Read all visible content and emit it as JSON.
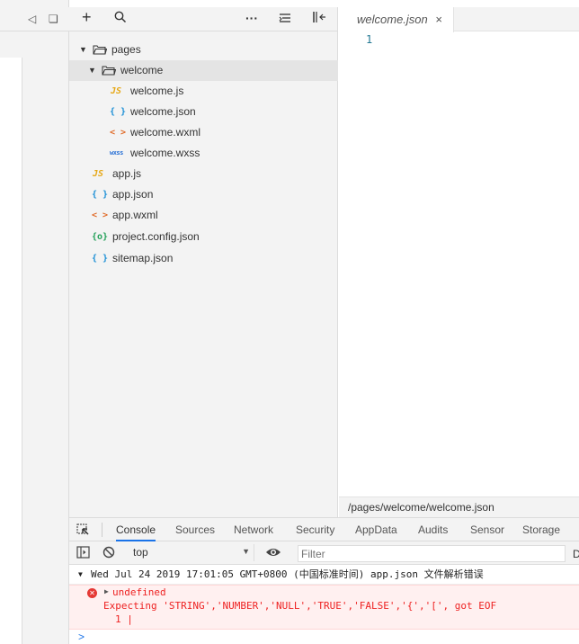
{
  "explorer": {
    "toolbar": {
      "add": "+",
      "more": "···"
    },
    "tree": [
      {
        "name": "pages",
        "type": "folder"
      },
      {
        "name": "welcome",
        "type": "folder"
      },
      {
        "name": "welcome.js",
        "type": "js",
        "icon": "JS"
      },
      {
        "name": "welcome.json",
        "type": "json",
        "icon": "{ }"
      },
      {
        "name": "welcome.wxml",
        "type": "wxml",
        "icon": "< >"
      },
      {
        "name": "welcome.wxss",
        "type": "wxss",
        "icon": "wxss"
      },
      {
        "name": "app.js",
        "type": "js",
        "icon": "JS"
      },
      {
        "name": "app.json",
        "type": "json",
        "icon": "{ }"
      },
      {
        "name": "app.wxml",
        "type": "wxml",
        "icon": "< >"
      },
      {
        "name": "project.config.json",
        "type": "config",
        "icon": "{o}"
      },
      {
        "name": "sitemap.json",
        "type": "json",
        "icon": "{ }"
      }
    ]
  },
  "editor": {
    "tab_title": "welcome.json",
    "tab_close": "×",
    "line_number": "1",
    "status_path": "/pages/welcome/welcome.json"
  },
  "devtools": {
    "tabs": [
      "Console",
      "Sources",
      "Network",
      "Security",
      "AppData",
      "Audits",
      "Sensor",
      "Storage"
    ],
    "context": "top",
    "filter_placeholder": "Filter",
    "right_cut": "D",
    "log_group": "Wed Jul 24 2019 17:01:05 GMT+0800 (中国标准时间)  app.json 文件解析错误",
    "error_title": "undefined",
    "error_message": "Expecting 'STRING','NUMBER','NULL','TRUE','FALSE','{','[', got EOF",
    "error_line": "1 |",
    "prompt": ">"
  },
  "colors": {
    "accent": "#1a73e8",
    "error": "#e53935",
    "js": "#e6a817",
    "json": "#1e90d6",
    "wxml": "#e06c2a",
    "config": "#25a15a"
  }
}
